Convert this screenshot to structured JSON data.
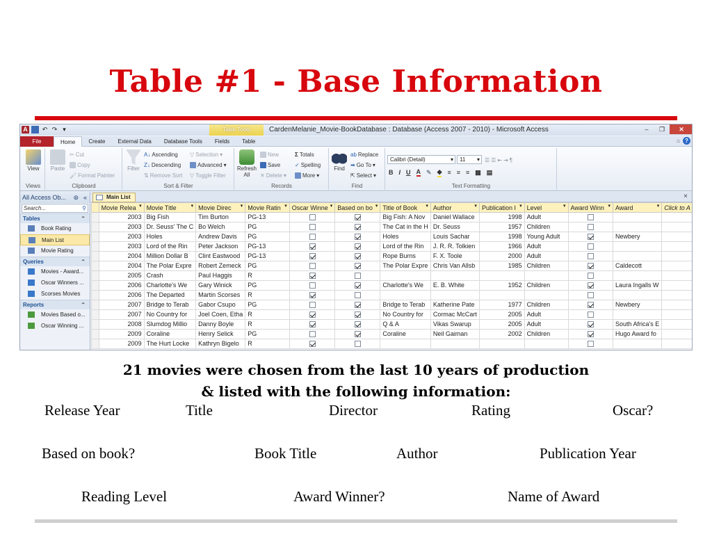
{
  "slide": {
    "title": "Table #1 - Base Information",
    "caption_line1": "21 movies were chosen from the last 10 years of production",
    "caption_line2": "& listed with the following information:",
    "fields": [
      "Release Year",
      "Title",
      "Director",
      "Rating",
      "Oscar?",
      "Based on book?",
      "Book Title",
      "Author",
      "Publication Year",
      "Reading Level",
      "Award Winner?",
      "Name of Award"
    ]
  },
  "window": {
    "title": "CardenMelanie_Movie-BookDatabase : Database (Access 2007 - 2010)  -  Microsoft Access",
    "context_tab": "Table Tools",
    "tabs": [
      "File",
      "Home",
      "Create",
      "External Data",
      "Database Tools",
      "Fields",
      "Table"
    ],
    "active_tab": "Home"
  },
  "ribbon": {
    "view": "View",
    "paste": "Paste",
    "cut": "Cut",
    "copy": "Copy",
    "format_painter": "Format Painter",
    "filter": "Filter",
    "ascending": "Ascending",
    "descending": "Descending",
    "remove_sort": "Remove Sort",
    "selection": "Selection",
    "advanced": "Advanced",
    "toggle_filter": "Toggle Filter",
    "refresh": "Refresh",
    "refresh_all": "All",
    "new": "New",
    "save": "Save",
    "delete": "Delete",
    "totals": "Totals",
    "spelling": "Spelling",
    "more": "More",
    "find": "Find",
    "replace": "Replace",
    "go_to": "Go To",
    "select": "Select",
    "font_name": "Calibri (Detail)",
    "font_size": "11",
    "groups": {
      "views": "Views",
      "clipboard": "Clipboard",
      "sort_filter": "Sort & Filter",
      "records": "Records",
      "find": "Find",
      "text_formatting": "Text Formatting"
    }
  },
  "nav": {
    "header": "All Access Ob...",
    "search_placeholder": "Search...",
    "categories": [
      {
        "label": "Tables",
        "items": [
          "Book Rating",
          "Main List",
          "Movie Rating"
        ]
      },
      {
        "label": "Queries",
        "items": [
          "Movies - Award...",
          "Oscar Winners ...",
          "Scorses Movies"
        ]
      },
      {
        "label": "Reports",
        "items": [
          "Movies Based o...",
          "Oscar Winning ..."
        ]
      }
    ],
    "selected_item": "Main List"
  },
  "doc": {
    "tab_label": "Main List",
    "columns": [
      "Movie Relea",
      "Movie Title",
      "Movie Direc",
      "Movie Ratin",
      "Oscar Winne",
      "Based on bo",
      "Title of Book",
      "Author",
      "Publication I",
      "Level",
      "Award Winn",
      "Award",
      "Click to A"
    ],
    "rows": [
      {
        "year": "2003",
        "title": "Big Fish",
        "director": "Tim Burton",
        "rating": "PG-13",
        "oscar": false,
        "book": true,
        "book_title": "Big Fish: A Nov",
        "author": "Daniel Wallace",
        "pub": "1998",
        "level": "Adult",
        "award_winner": false,
        "award": ""
      },
      {
        "year": "2003",
        "title": "Dr. Seuss' The C",
        "director": "Bo Welch",
        "rating": "PG",
        "oscar": false,
        "book": true,
        "book_title": "The Cat in the H",
        "author": "Dr. Seuss",
        "pub": "1957",
        "level": "Children",
        "award_winner": false,
        "award": ""
      },
      {
        "year": "2003",
        "title": "Holes",
        "director": "Andrew Davis",
        "rating": "PG",
        "oscar": false,
        "book": true,
        "book_title": "Holes",
        "author": "Louis Sachar",
        "pub": "1998",
        "level": "Young Adult",
        "award_winner": true,
        "award": "Newbery"
      },
      {
        "year": "2003",
        "title": "Lord of the Rin",
        "director": "Peter Jackson",
        "rating": "PG-13",
        "oscar": true,
        "book": true,
        "book_title": "Lord of the Rin",
        "author": "J. R. R. Tolkien",
        "pub": "1966",
        "level": "Adult",
        "award_winner": false,
        "award": ""
      },
      {
        "year": "2004",
        "title": "Million Dollar B",
        "director": "Clint Eastwood",
        "rating": "PG-13",
        "oscar": true,
        "book": true,
        "book_title": "Rope Burns",
        "author": "F. X. Toole",
        "pub": "2000",
        "level": "Adult",
        "award_winner": false,
        "award": ""
      },
      {
        "year": "2004",
        "title": "The Polar Expre",
        "director": "Robert Zemeck",
        "rating": "PG",
        "oscar": false,
        "book": true,
        "book_title": "The Polar Expre",
        "author": "Chris Van Allsb",
        "pub": "1985",
        "level": "Children",
        "award_winner": true,
        "award": "Caldecott"
      },
      {
        "year": "2005",
        "title": "Crash",
        "director": "Paul Haggis",
        "rating": "R",
        "oscar": true,
        "book": false,
        "book_title": "",
        "author": "",
        "pub": "",
        "level": "",
        "award_winner": false,
        "award": ""
      },
      {
        "year": "2006",
        "title": "Charlotte's We",
        "director": "Gary Winick",
        "rating": "PG",
        "oscar": false,
        "book": true,
        "book_title": "Charlotte's We",
        "author": "E. B. White",
        "pub": "1952",
        "level": "Children",
        "award_winner": true,
        "award": "Laura Ingalls W"
      },
      {
        "year": "2006",
        "title": "The Departed",
        "director": "Martin Scorses",
        "rating": "R",
        "oscar": true,
        "book": false,
        "book_title": "",
        "author": "",
        "pub": "",
        "level": "",
        "award_winner": false,
        "award": ""
      },
      {
        "year": "2007",
        "title": "Bridge to Terab",
        "director": "Gabor Csupo",
        "rating": "PG",
        "oscar": false,
        "book": true,
        "book_title": "Bridge to Terab",
        "author": "Katherine Pate",
        "pub": "1977",
        "level": "Children",
        "award_winner": true,
        "award": "Newbery"
      },
      {
        "year": "2007",
        "title": "No Country for",
        "director": "Joel Coen, Etha",
        "rating": "R",
        "oscar": true,
        "book": true,
        "book_title": "No Country for",
        "author": "Cormac McCart",
        "pub": "2005",
        "level": "Adult",
        "award_winner": false,
        "award": ""
      },
      {
        "year": "2008",
        "title": "Slumdog Millio",
        "director": "Danny Boyle",
        "rating": "R",
        "oscar": true,
        "book": true,
        "book_title": "Q & A",
        "author": "Vikas Swarup",
        "pub": "2005",
        "level": "Adult",
        "award_winner": true,
        "award": "South Africa's E"
      },
      {
        "year": "2009",
        "title": "Coraline",
        "director": "Henry Selick",
        "rating": "PG",
        "oscar": false,
        "book": true,
        "book_title": "Coraline",
        "author": "Neil Gaiman",
        "pub": "2002",
        "level": "Children",
        "award_winner": true,
        "award": "Hugo Award fo"
      },
      {
        "year": "2009",
        "title": "The Hurt Locke",
        "director": "Kathryn Bigelo",
        "rating": "R",
        "oscar": true,
        "book": false,
        "book_title": "",
        "author": "",
        "pub": "",
        "level": "",
        "award_winner": false,
        "award": ""
      }
    ]
  },
  "colors": {
    "title_red": "#d7070d",
    "file_tab": "#b4222b",
    "header_yellow": "#fdf2bd"
  }
}
